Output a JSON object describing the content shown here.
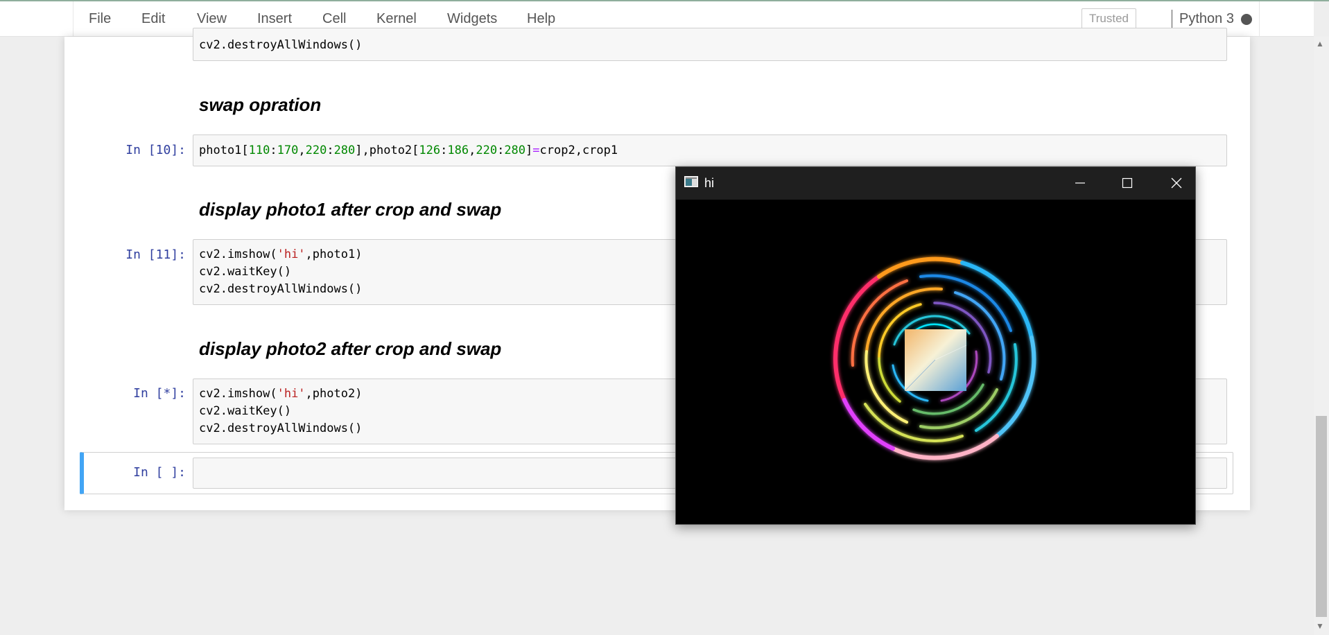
{
  "menu": {
    "items": [
      "File",
      "Edit",
      "View",
      "Insert",
      "Cell",
      "Kernel",
      "Widgets",
      "Help"
    ],
    "trusted_label": "Trusted",
    "kernel_name": "Python 3"
  },
  "cells": {
    "top_partial": {
      "line": "cv2.destroyAllWindows()"
    },
    "md1": "swap opration",
    "code10": {
      "prompt": "In [10]:"
    },
    "md2": "display photo1 after crop and swap",
    "code11": {
      "prompt": "In [11]:",
      "lines": [
        "cv2.imshow('hi',photo1)",
        "cv2.waitKey()",
        "cv2.destroyAllWindows()"
      ]
    },
    "md3": "display photo2 after crop and swap",
    "code_running": {
      "prompt": "In [*]:",
      "lines": [
        "cv2.imshow('hi',photo2)",
        "cv2.waitKey()",
        "cv2.destroyAllWindows()"
      ]
    },
    "empty": {
      "prompt": "In [ ]:"
    }
  },
  "image_window": {
    "title": "hi"
  },
  "colors": {
    "prompt": "#303f9f",
    "selected_cell_border": "#42a5f5",
    "number": "#008800",
    "string": "#ba2121"
  }
}
